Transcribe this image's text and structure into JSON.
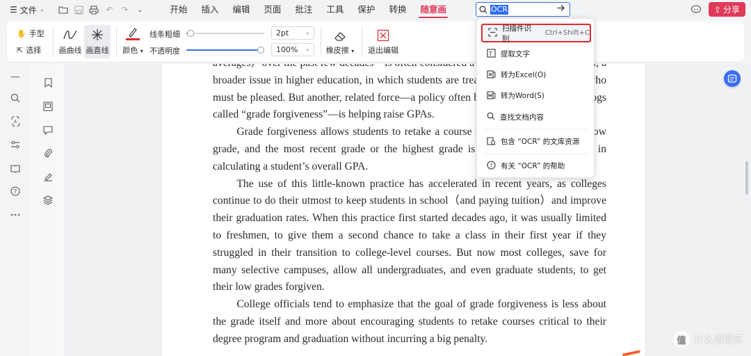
{
  "colors": {
    "accent": "#e0395a",
    "primary": "#3a6ff0",
    "highlight_border": "#e02b2b"
  },
  "topbar": {
    "file_label": "文件",
    "tabs": [
      {
        "label": "开始"
      },
      {
        "label": "插入"
      },
      {
        "label": "编辑"
      },
      {
        "label": "页面"
      },
      {
        "label": "批注"
      },
      {
        "label": "工具"
      },
      {
        "label": "保护"
      },
      {
        "label": "转换"
      },
      {
        "label": "随意画",
        "active": true
      }
    ],
    "search": {
      "value": "OCR"
    },
    "share_label": "分享"
  },
  "ribbon": {
    "hand_tool": "手型",
    "select_tool": "选择",
    "curve_tool": "画曲线",
    "line_tool": "画直线",
    "color_label": "颜色",
    "line_width_label": "线条粗细",
    "line_width_value": "2pt",
    "opacity_label": "不透明度",
    "opacity_value": "100%",
    "eraser_label": "橡皮擦",
    "exit_label": "退出编辑",
    "line_width_slider": 0.05,
    "opacity_slider": 1.0
  },
  "dropdown": {
    "items": [
      {
        "label": "扫描件识别",
        "shortcut": "Ctrl+Shift+C",
        "icon": "scan-icon",
        "highlighted": true
      },
      {
        "label": "提取文字",
        "icon": "extract-text-icon"
      },
      {
        "label": "转为Excel(O)",
        "icon": "excel-icon"
      },
      {
        "label": "转为Word(S)",
        "icon": "word-icon"
      },
      {
        "label": "查找文档内容",
        "icon": "search-icon"
      },
      {
        "label": "包含 “OCR” 的文库资源",
        "icon": "library-icon"
      },
      {
        "label": "有关 “OCR” 的帮助",
        "icon": "help-icon"
      }
    ]
  },
  "document": {
    "paragraphs": [
      {
        "indent": false,
        "text": "averages）over the past few decades—is often considered a symptom of grade inflation, a broader issue in higher education, in which students are treated more like customers who must be pleased. But another, related force—a policy often buried deep in course catalogs called “grade forgiveness”—is helping raise GPAs."
      },
      {
        "indent": true,
        "text": "Grade forgiveness allows students to retake a course in which they received a low grade, and the most recent grade or the highest grade is the only one that counts in calculating a student’s overall GPA."
      },
      {
        "indent": true,
        "text": "The use of this little-known practice has accelerated in recent years, as colleges continue to do their utmost to keep students in school（and paying tuition）and improve their graduation rates. When this practice first started decades ago, it was usually limited to freshmen, to give them a second chance to take a class in their first year if they struggled in their transition to college-level courses. But now most colleges, save for many selective campuses, allow all undergraduates, and even graduate students, to get their low grades forgiven."
      },
      {
        "indent": true,
        "text": "College officials tend to emphasize that the goal of grade forgiveness is less about the grade itself and more about encouraging students to retake courses critical to their degree program and graduation without incurring a big penalty."
      }
    ]
  },
  "watermark": {
    "text": "什么值得买"
  }
}
